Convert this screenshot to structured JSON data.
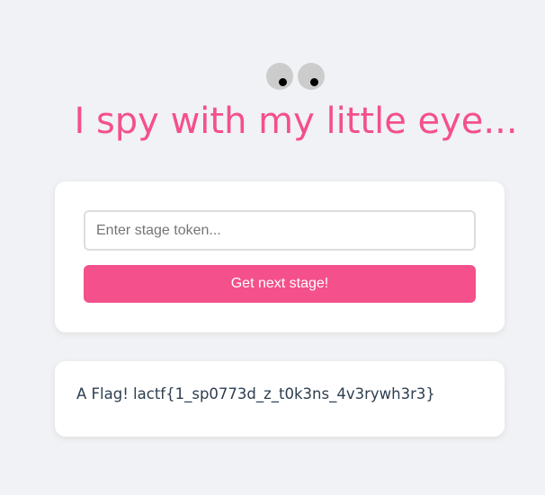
{
  "header": {
    "title": "I spy with my little eye..."
  },
  "form": {
    "token_placeholder": "Enter stage token...",
    "token_value": "",
    "submit_label": "Get next stage!"
  },
  "result": {
    "message": "A Flag! lactf{1_sp0773d_z_t0k3ns_4v3rywh3r3}"
  },
  "colors": {
    "accent": "#f4508b",
    "background": "#f0f2f5",
    "card": "#ffffff",
    "text": "#2c3e50"
  }
}
